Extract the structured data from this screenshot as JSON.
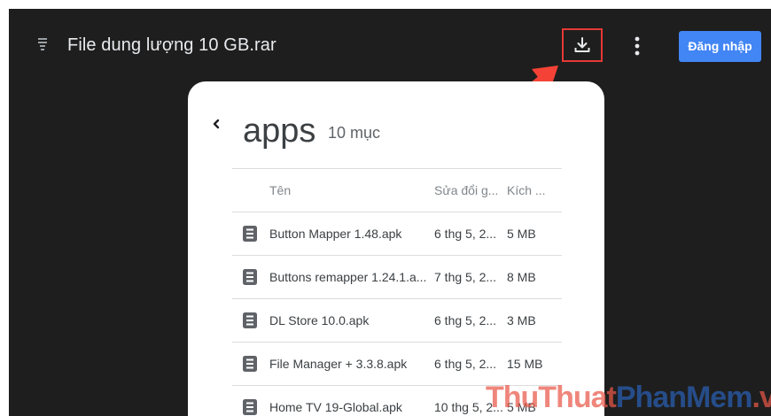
{
  "header": {
    "file_title": "File dung lượng 10 GB.rar",
    "download_icon": "download-icon",
    "more_icon": "more-vert-icon",
    "login_label": "Đăng nhập"
  },
  "folder": {
    "name": "apps",
    "count": "10 mục"
  },
  "table": {
    "columns": [
      "Tên",
      "Sửa đổi g...",
      "Kích ..."
    ],
    "rows": [
      {
        "name": "Button Mapper 1.48.apk",
        "modified": "6 thg 5, 2...",
        "size": "5 MB"
      },
      {
        "name": "Buttons remapper 1.24.1.a...",
        "modified": "7 thg 5, 2...",
        "size": "8 MB"
      },
      {
        "name": "DL Store 10.0.apk",
        "modified": "6 thg 5, 2...",
        "size": "3 MB"
      },
      {
        "name": "File Manager + 3.3.8.apk",
        "modified": "6 thg 5, 2...",
        "size": "15 MB"
      },
      {
        "name": "Home TV 19-Global.apk",
        "modified": "10 thg 5, 2...",
        "size": "5 MB"
      }
    ]
  },
  "colors": {
    "background": "#1e1e1e",
    "accent": "#4285f4",
    "highlight": "#e53935"
  },
  "watermark": {
    "part1": "ThuThuat",
    "part2": "PhanMem",
    "part3": ".vn"
  }
}
